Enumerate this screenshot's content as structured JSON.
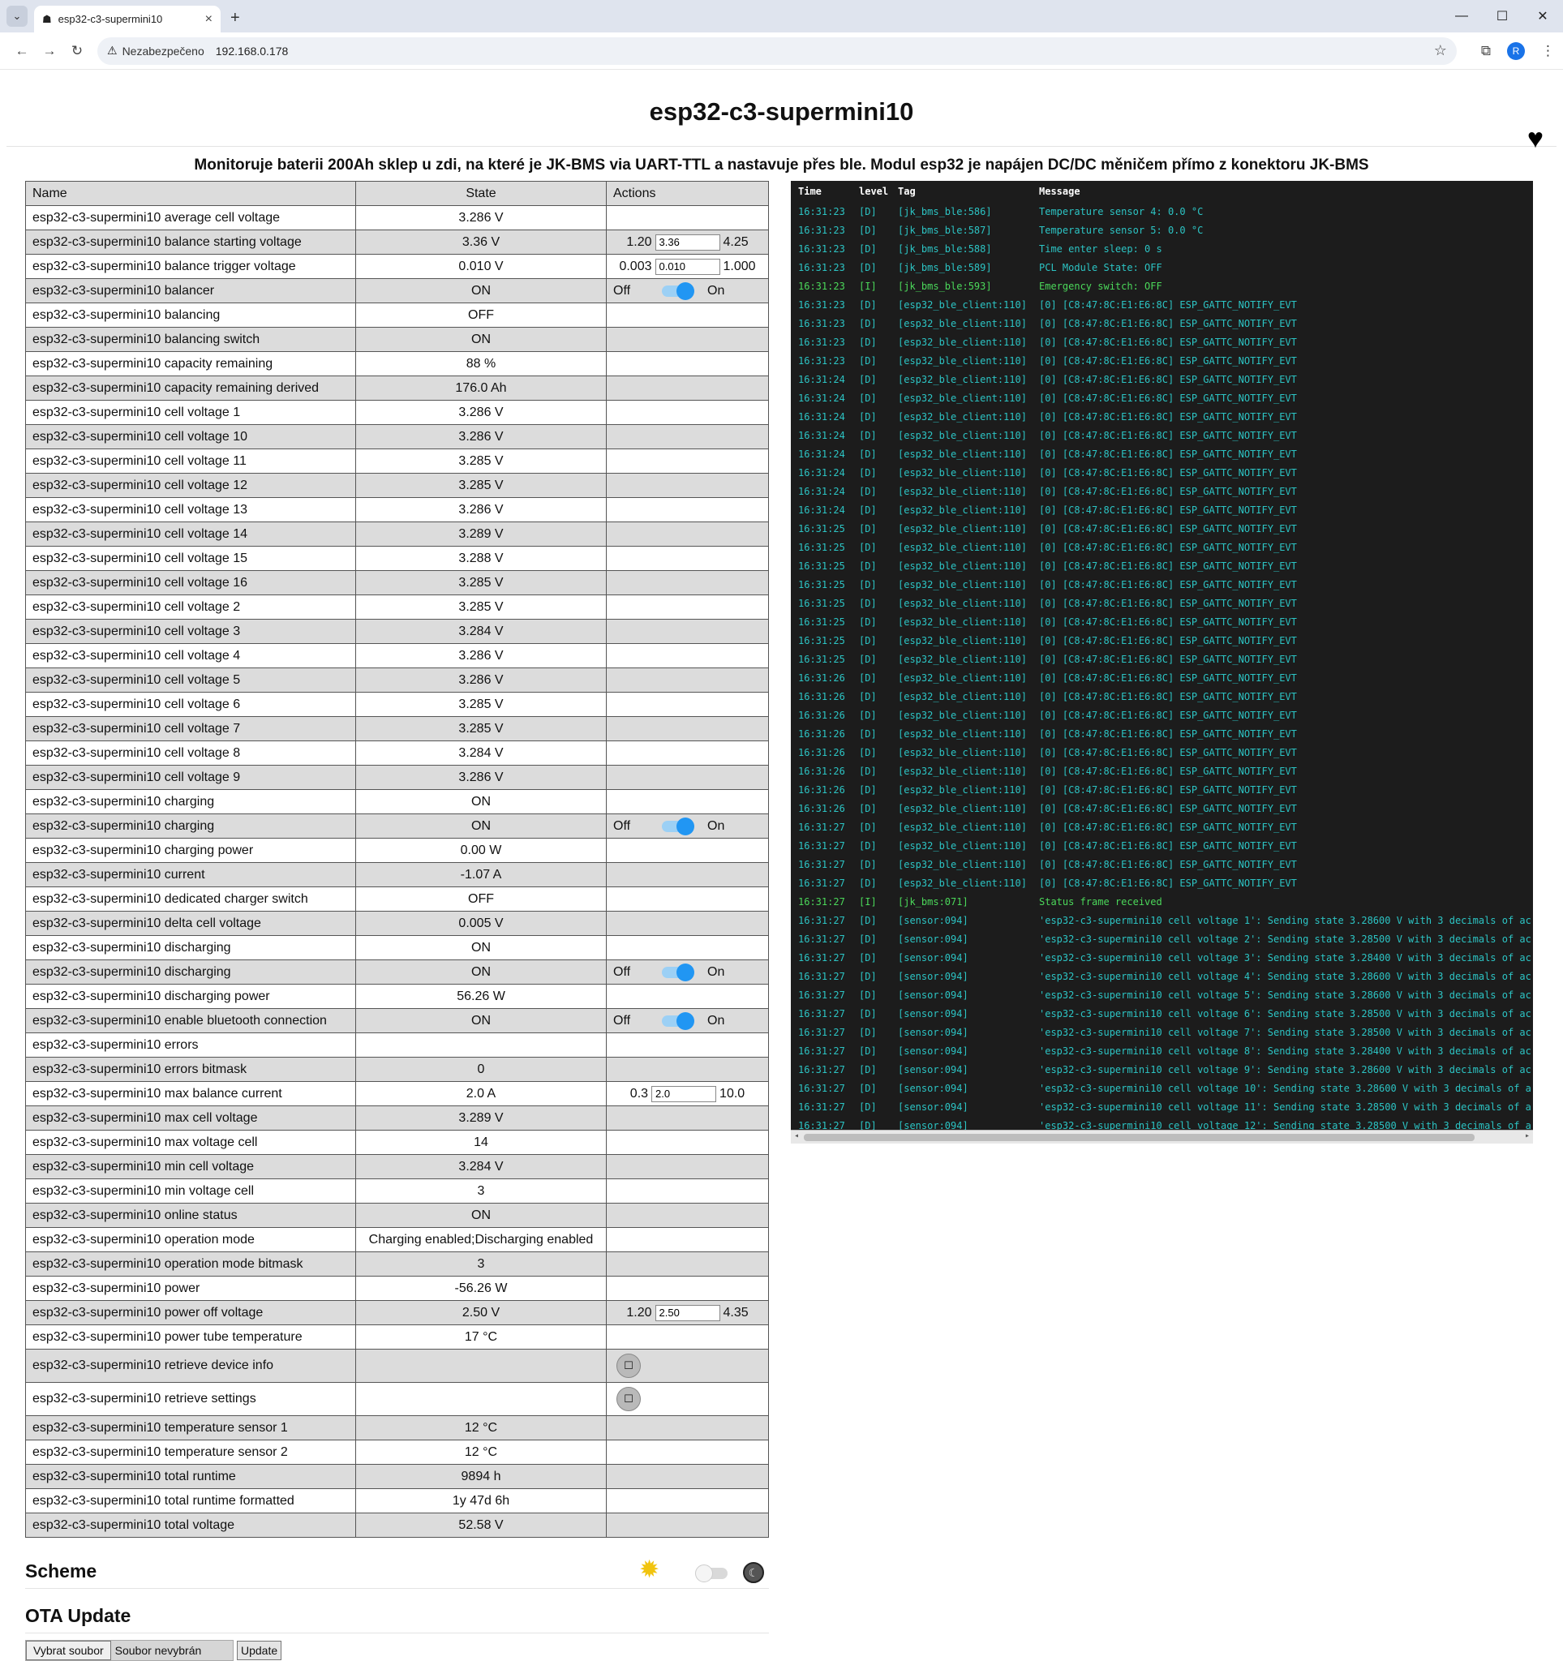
{
  "browser": {
    "tab_title": "esp32-c3-supermini10",
    "tab_list_icon": "chevron-down-icon",
    "insecure_label": "Nezabezpečeno",
    "url": "192.168.0.178"
  },
  "page": {
    "title": "esp32-c3-supermini10",
    "description": "Monitoruje baterii 200Ah sklep u zdi, na které je JK-BMS via UART-TTL a nastavuje přes ble. Modul esp32 je napájen DC/DC měničem přímo z konektoru JK-BMS"
  },
  "table": {
    "headers": {
      "name": "Name",
      "state": "State",
      "actions": "Actions"
    },
    "rows": [
      {
        "name": "esp32-c3-supermini10 average cell voltage",
        "state": "3.286 V"
      },
      {
        "name": "esp32-c3-supermini10 balance starting voltage",
        "state": "3.36 V",
        "action": {
          "type": "number",
          "min": "1.20",
          "value": "3.36",
          "max": "4.25"
        }
      },
      {
        "name": "esp32-c3-supermini10 balance trigger voltage",
        "state": "0.010 V",
        "action": {
          "type": "number",
          "min": "0.003",
          "value": "0.010",
          "max": "1.000"
        }
      },
      {
        "name": "esp32-c3-supermini10 balancer",
        "state": "ON",
        "action": {
          "type": "switch",
          "off": "Off",
          "on": "On"
        }
      },
      {
        "name": "esp32-c3-supermini10 balancing",
        "state": "OFF"
      },
      {
        "name": "esp32-c3-supermini10 balancing switch",
        "state": "ON"
      },
      {
        "name": "esp32-c3-supermini10 capacity remaining",
        "state": "88 %"
      },
      {
        "name": "esp32-c3-supermini10 capacity remaining derived",
        "state": "176.0 Ah"
      },
      {
        "name": "esp32-c3-supermini10 cell voltage 1",
        "state": "3.286 V"
      },
      {
        "name": "esp32-c3-supermini10 cell voltage 10",
        "state": "3.286 V"
      },
      {
        "name": "esp32-c3-supermini10 cell voltage 11",
        "state": "3.285 V"
      },
      {
        "name": "esp32-c3-supermini10 cell voltage 12",
        "state": "3.285 V"
      },
      {
        "name": "esp32-c3-supermini10 cell voltage 13",
        "state": "3.286 V"
      },
      {
        "name": "esp32-c3-supermini10 cell voltage 14",
        "state": "3.289 V"
      },
      {
        "name": "esp32-c3-supermini10 cell voltage 15",
        "state": "3.288 V"
      },
      {
        "name": "esp32-c3-supermini10 cell voltage 16",
        "state": "3.285 V"
      },
      {
        "name": "esp32-c3-supermini10 cell voltage 2",
        "state": "3.285 V"
      },
      {
        "name": "esp32-c3-supermini10 cell voltage 3",
        "state": "3.284 V"
      },
      {
        "name": "esp32-c3-supermini10 cell voltage 4",
        "state": "3.286 V"
      },
      {
        "name": "esp32-c3-supermini10 cell voltage 5",
        "state": "3.286 V"
      },
      {
        "name": "esp32-c3-supermini10 cell voltage 6",
        "state": "3.285 V"
      },
      {
        "name": "esp32-c3-supermini10 cell voltage 7",
        "state": "3.285 V"
      },
      {
        "name": "esp32-c3-supermini10 cell voltage 8",
        "state": "3.284 V"
      },
      {
        "name": "esp32-c3-supermini10 cell voltage 9",
        "state": "3.286 V"
      },
      {
        "name": "esp32-c3-supermini10 charging",
        "state": "ON"
      },
      {
        "name": "esp32-c3-supermini10 charging",
        "state": "ON",
        "action": {
          "type": "switch",
          "off": "Off",
          "on": "On"
        }
      },
      {
        "name": "esp32-c3-supermini10 charging power",
        "state": "0.00 W"
      },
      {
        "name": "esp32-c3-supermini10 current",
        "state": "-1.07 A"
      },
      {
        "name": "esp32-c3-supermini10 dedicated charger switch",
        "state": "OFF"
      },
      {
        "name": "esp32-c3-supermini10 delta cell voltage",
        "state": "0.005 V"
      },
      {
        "name": "esp32-c3-supermini10 discharging",
        "state": "ON"
      },
      {
        "name": "esp32-c3-supermini10 discharging",
        "state": "ON",
        "action": {
          "type": "switch",
          "off": "Off",
          "on": "On"
        }
      },
      {
        "name": "esp32-c3-supermini10 discharging power",
        "state": "56.26 W"
      },
      {
        "name": "esp32-c3-supermini10 enable bluetooth connection",
        "state": "ON",
        "action": {
          "type": "switch",
          "off": "Off",
          "on": "On"
        }
      },
      {
        "name": "esp32-c3-supermini10 errors",
        "state": ""
      },
      {
        "name": "esp32-c3-supermini10 errors bitmask",
        "state": "0"
      },
      {
        "name": "esp32-c3-supermini10 max balance current",
        "state": "2.0 A",
        "action": {
          "type": "number",
          "min": "0.3",
          "value": "2.0",
          "max": "10.0"
        }
      },
      {
        "name": "esp32-c3-supermini10 max cell voltage",
        "state": "3.289 V"
      },
      {
        "name": "esp32-c3-supermini10 max voltage cell",
        "state": "14"
      },
      {
        "name": "esp32-c3-supermini10 min cell voltage",
        "state": "3.284 V"
      },
      {
        "name": "esp32-c3-supermini10 min voltage cell",
        "state": "3"
      },
      {
        "name": "esp32-c3-supermini10 online status",
        "state": "ON"
      },
      {
        "name": "esp32-c3-supermini10 operation mode",
        "state": "Charging enabled;Discharging enabled"
      },
      {
        "name": "esp32-c3-supermini10 operation mode bitmask",
        "state": "3"
      },
      {
        "name": "esp32-c3-supermini10 power",
        "state": "-56.26 W"
      },
      {
        "name": "esp32-c3-supermini10 power off voltage",
        "state": "2.50 V",
        "action": {
          "type": "number",
          "min": "1.20",
          "value": "2.50",
          "max": "4.35"
        }
      },
      {
        "name": "esp32-c3-supermini10 power tube temperature",
        "state": "17 °C"
      },
      {
        "name": "esp32-c3-supermini10 retrieve device info",
        "state": "",
        "action": {
          "type": "button",
          "label": "☐"
        }
      },
      {
        "name": "esp32-c3-supermini10 retrieve settings",
        "state": "",
        "action": {
          "type": "button",
          "label": "☐"
        }
      },
      {
        "name": "esp32-c3-supermini10 temperature sensor 1",
        "state": "12 °C"
      },
      {
        "name": "esp32-c3-supermini10 temperature sensor 2",
        "state": "12 °C"
      },
      {
        "name": "esp32-c3-supermini10 total runtime",
        "state": "9894 h"
      },
      {
        "name": "esp32-c3-supermini10 total runtime formatted",
        "state": "1y 47d 6h"
      },
      {
        "name": "esp32-c3-supermini10 total voltage",
        "state": "52.58 V"
      }
    ]
  },
  "log": {
    "headers": {
      "time": "Time",
      "level": "level",
      "tag": "Tag",
      "message": "Message"
    },
    "colors": {
      "debug": "#2cc4c4",
      "info": "#4bd85a",
      "background": "#1c1c1c"
    },
    "rows": [
      {
        "t": "16:31:23",
        "l": "[D]",
        "g": "[jk_bms_ble:586]",
        "m": "Temperature sensor 4: 0.0 °C"
      },
      {
        "t": "16:31:23",
        "l": "[D]",
        "g": "[jk_bms_ble:587]",
        "m": "Temperature sensor 5: 0.0 °C"
      },
      {
        "t": "16:31:23",
        "l": "[D]",
        "g": "[jk_bms_ble:588]",
        "m": "Time enter sleep: 0 s"
      },
      {
        "t": "16:31:23",
        "l": "[D]",
        "g": "[jk_bms_ble:589]",
        "m": "PCL Module State: OFF"
      },
      {
        "t": "16:31:23",
        "l": "[I]",
        "g": "[jk_bms_ble:593]",
        "m": "Emergency switch: OFF"
      },
      {
        "t": "16:31:23",
        "l": "[D]",
        "g": "[esp32_ble_client:110]",
        "m": "[0] [C8:47:8C:E1:E6:8C] ESP_GATTC_NOTIFY_EVT"
      },
      {
        "t": "16:31:23",
        "l": "[D]",
        "g": "[esp32_ble_client:110]",
        "m": "[0] [C8:47:8C:E1:E6:8C] ESP_GATTC_NOTIFY_EVT"
      },
      {
        "t": "16:31:23",
        "l": "[D]",
        "g": "[esp32_ble_client:110]",
        "m": "[0] [C8:47:8C:E1:E6:8C] ESP_GATTC_NOTIFY_EVT"
      },
      {
        "t": "16:31:23",
        "l": "[D]",
        "g": "[esp32_ble_client:110]",
        "m": "[0] [C8:47:8C:E1:E6:8C] ESP_GATTC_NOTIFY_EVT"
      },
      {
        "t": "16:31:24",
        "l": "[D]",
        "g": "[esp32_ble_client:110]",
        "m": "[0] [C8:47:8C:E1:E6:8C] ESP_GATTC_NOTIFY_EVT"
      },
      {
        "t": "16:31:24",
        "l": "[D]",
        "g": "[esp32_ble_client:110]",
        "m": "[0] [C8:47:8C:E1:E6:8C] ESP_GATTC_NOTIFY_EVT"
      },
      {
        "t": "16:31:24",
        "l": "[D]",
        "g": "[esp32_ble_client:110]",
        "m": "[0] [C8:47:8C:E1:E6:8C] ESP_GATTC_NOTIFY_EVT"
      },
      {
        "t": "16:31:24",
        "l": "[D]",
        "g": "[esp32_ble_client:110]",
        "m": "[0] [C8:47:8C:E1:E6:8C] ESP_GATTC_NOTIFY_EVT"
      },
      {
        "t": "16:31:24",
        "l": "[D]",
        "g": "[esp32_ble_client:110]",
        "m": "[0] [C8:47:8C:E1:E6:8C] ESP_GATTC_NOTIFY_EVT"
      },
      {
        "t": "16:31:24",
        "l": "[D]",
        "g": "[esp32_ble_client:110]",
        "m": "[0] [C8:47:8C:E1:E6:8C] ESP_GATTC_NOTIFY_EVT"
      },
      {
        "t": "16:31:24",
        "l": "[D]",
        "g": "[esp32_ble_client:110]",
        "m": "[0] [C8:47:8C:E1:E6:8C] ESP_GATTC_NOTIFY_EVT"
      },
      {
        "t": "16:31:24",
        "l": "[D]",
        "g": "[esp32_ble_client:110]",
        "m": "[0] [C8:47:8C:E1:E6:8C] ESP_GATTC_NOTIFY_EVT"
      },
      {
        "t": "16:31:25",
        "l": "[D]",
        "g": "[esp32_ble_client:110]",
        "m": "[0] [C8:47:8C:E1:E6:8C] ESP_GATTC_NOTIFY_EVT"
      },
      {
        "t": "16:31:25",
        "l": "[D]",
        "g": "[esp32_ble_client:110]",
        "m": "[0] [C8:47:8C:E1:E6:8C] ESP_GATTC_NOTIFY_EVT"
      },
      {
        "t": "16:31:25",
        "l": "[D]",
        "g": "[esp32_ble_client:110]",
        "m": "[0] [C8:47:8C:E1:E6:8C] ESP_GATTC_NOTIFY_EVT"
      },
      {
        "t": "16:31:25",
        "l": "[D]",
        "g": "[esp32_ble_client:110]",
        "m": "[0] [C8:47:8C:E1:E6:8C] ESP_GATTC_NOTIFY_EVT"
      },
      {
        "t": "16:31:25",
        "l": "[D]",
        "g": "[esp32_ble_client:110]",
        "m": "[0] [C8:47:8C:E1:E6:8C] ESP_GATTC_NOTIFY_EVT"
      },
      {
        "t": "16:31:25",
        "l": "[D]",
        "g": "[esp32_ble_client:110]",
        "m": "[0] [C8:47:8C:E1:E6:8C] ESP_GATTC_NOTIFY_EVT"
      },
      {
        "t": "16:31:25",
        "l": "[D]",
        "g": "[esp32_ble_client:110]",
        "m": "[0] [C8:47:8C:E1:E6:8C] ESP_GATTC_NOTIFY_EVT"
      },
      {
        "t": "16:31:25",
        "l": "[D]",
        "g": "[esp32_ble_client:110]",
        "m": "[0] [C8:47:8C:E1:E6:8C] ESP_GATTC_NOTIFY_EVT"
      },
      {
        "t": "16:31:26",
        "l": "[D]",
        "g": "[esp32_ble_client:110]",
        "m": "[0] [C8:47:8C:E1:E6:8C] ESP_GATTC_NOTIFY_EVT"
      },
      {
        "t": "16:31:26",
        "l": "[D]",
        "g": "[esp32_ble_client:110]",
        "m": "[0] [C8:47:8C:E1:E6:8C] ESP_GATTC_NOTIFY_EVT"
      },
      {
        "t": "16:31:26",
        "l": "[D]",
        "g": "[esp32_ble_client:110]",
        "m": "[0] [C8:47:8C:E1:E6:8C] ESP_GATTC_NOTIFY_EVT"
      },
      {
        "t": "16:31:26",
        "l": "[D]",
        "g": "[esp32_ble_client:110]",
        "m": "[0] [C8:47:8C:E1:E6:8C] ESP_GATTC_NOTIFY_EVT"
      },
      {
        "t": "16:31:26",
        "l": "[D]",
        "g": "[esp32_ble_client:110]",
        "m": "[0] [C8:47:8C:E1:E6:8C] ESP_GATTC_NOTIFY_EVT"
      },
      {
        "t": "16:31:26",
        "l": "[D]",
        "g": "[esp32_ble_client:110]",
        "m": "[0] [C8:47:8C:E1:E6:8C] ESP_GATTC_NOTIFY_EVT"
      },
      {
        "t": "16:31:26",
        "l": "[D]",
        "g": "[esp32_ble_client:110]",
        "m": "[0] [C8:47:8C:E1:E6:8C] ESP_GATTC_NOTIFY_EVT"
      },
      {
        "t": "16:31:26",
        "l": "[D]",
        "g": "[esp32_ble_client:110]",
        "m": "[0] [C8:47:8C:E1:E6:8C] ESP_GATTC_NOTIFY_EVT"
      },
      {
        "t": "16:31:27",
        "l": "[D]",
        "g": "[esp32_ble_client:110]",
        "m": "[0] [C8:47:8C:E1:E6:8C] ESP_GATTC_NOTIFY_EVT"
      },
      {
        "t": "16:31:27",
        "l": "[D]",
        "g": "[esp32_ble_client:110]",
        "m": "[0] [C8:47:8C:E1:E6:8C] ESP_GATTC_NOTIFY_EVT"
      },
      {
        "t": "16:31:27",
        "l": "[D]",
        "g": "[esp32_ble_client:110]",
        "m": "[0] [C8:47:8C:E1:E6:8C] ESP_GATTC_NOTIFY_EVT"
      },
      {
        "t": "16:31:27",
        "l": "[D]",
        "g": "[esp32_ble_client:110]",
        "m": "[0] [C8:47:8C:E1:E6:8C] ESP_GATTC_NOTIFY_EVT"
      },
      {
        "t": "16:31:27",
        "l": "[I]",
        "g": "[jk_bms:071]",
        "m": "Status frame received"
      },
      {
        "t": "16:31:27",
        "l": "[D]",
        "g": "[sensor:094]",
        "m": "'esp32-c3-supermini10 cell voltage 1': Sending state 3.28600 V with 3 decimals of ac"
      },
      {
        "t": "16:31:27",
        "l": "[D]",
        "g": "[sensor:094]",
        "m": "'esp32-c3-supermini10 cell voltage 2': Sending state 3.28500 V with 3 decimals of ac"
      },
      {
        "t": "16:31:27",
        "l": "[D]",
        "g": "[sensor:094]",
        "m": "'esp32-c3-supermini10 cell voltage 3': Sending state 3.28400 V with 3 decimals of ac"
      },
      {
        "t": "16:31:27",
        "l": "[D]",
        "g": "[sensor:094]",
        "m": "'esp32-c3-supermini10 cell voltage 4': Sending state 3.28600 V with 3 decimals of ac"
      },
      {
        "t": "16:31:27",
        "l": "[D]",
        "g": "[sensor:094]",
        "m": "'esp32-c3-supermini10 cell voltage 5': Sending state 3.28600 V with 3 decimals of ac"
      },
      {
        "t": "16:31:27",
        "l": "[D]",
        "g": "[sensor:094]",
        "m": "'esp32-c3-supermini10 cell voltage 6': Sending state 3.28500 V with 3 decimals of ac"
      },
      {
        "t": "16:31:27",
        "l": "[D]",
        "g": "[sensor:094]",
        "m": "'esp32-c3-supermini10 cell voltage 7': Sending state 3.28500 V with 3 decimals of ac"
      },
      {
        "t": "16:31:27",
        "l": "[D]",
        "g": "[sensor:094]",
        "m": "'esp32-c3-supermini10 cell voltage 8': Sending state 3.28400 V with 3 decimals of ac"
      },
      {
        "t": "16:31:27",
        "l": "[D]",
        "g": "[sensor:094]",
        "m": "'esp32-c3-supermini10 cell voltage 9': Sending state 3.28600 V with 3 decimals of ac"
      },
      {
        "t": "16:31:27",
        "l": "[D]",
        "g": "[sensor:094]",
        "m": "'esp32-c3-supermini10 cell voltage 10': Sending state 3.28600 V with 3 decimals of a"
      },
      {
        "t": "16:31:27",
        "l": "[D]",
        "g": "[sensor:094]",
        "m": "'esp32-c3-supermini10 cell voltage 11': Sending state 3.28500 V with 3 decimals of a"
      },
      {
        "t": "16:31:27",
        "l": "[D]",
        "g": "[sensor:094]",
        "m": "'esp32-c3-supermini10 cell voltage 12': Sending state 3.28500 V with 3 decimals of a"
      }
    ]
  },
  "scheme": {
    "title": "Scheme",
    "light_icon": "sun-icon",
    "dark_icon": "moon-icon"
  },
  "ota": {
    "title": "OTA Update",
    "choose_label": "Vybrat soubor",
    "no_file_label": "Soubor nevybrán",
    "update_label": "Update"
  }
}
